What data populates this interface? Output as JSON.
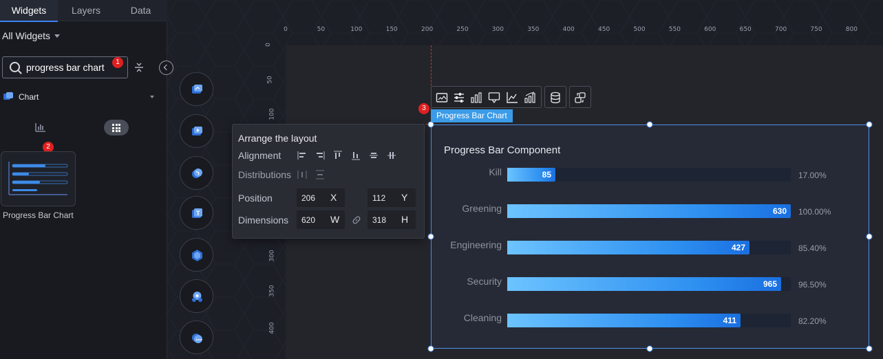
{
  "tabs": [
    {
      "label": "Widgets"
    },
    {
      "label": "Layers"
    },
    {
      "label": "Data"
    }
  ],
  "filter": {
    "label": "All Widgets"
  },
  "search": {
    "value": "progress bar chart"
  },
  "badges": [
    "1",
    "2",
    "3"
  ],
  "category": {
    "label": "Chart"
  },
  "widget": {
    "label": "Progress Bar Chart"
  },
  "ruler": {
    "top": [
      "0",
      "50",
      "100",
      "150",
      "200",
      "250",
      "300",
      "350",
      "400",
      "450",
      "500",
      "550",
      "600",
      "650",
      "700",
      "750",
      "800"
    ],
    "left": [
      "0",
      "50",
      "100",
      "300",
      "350",
      "400"
    ]
  },
  "arrange": {
    "title": "Arrange the layout",
    "alignment_label": "Alignment",
    "distributions_label": "Distributions",
    "position_label": "Position",
    "dimensions_label": "Dimensions",
    "x": "206",
    "x_unit": "X",
    "y": "112",
    "y_unit": "Y",
    "w": "620",
    "w_unit": "W",
    "h": "318",
    "h_unit": "H"
  },
  "selection": {
    "label": "Progress Bar Chart"
  },
  "chart_data": {
    "type": "bar",
    "title": "Progress Bar Component",
    "categories": [
      "Kill",
      "Greening",
      "Engineering",
      "Security",
      "Cleaning"
    ],
    "values": [
      85,
      630,
      427,
      965,
      411
    ],
    "percent_labels": [
      "17.00%",
      "100.00%",
      "85.40%",
      "96.50%",
      "82.20%"
    ],
    "fill_fraction": [
      0.17,
      1.0,
      0.854,
      0.965,
      0.822
    ],
    "colors": {
      "fill_start": "#6cc3ff",
      "fill_end": "#1a6fe0",
      "track": "#1d2433"
    }
  },
  "colors": {
    "accent": "#3b82f6",
    "selection": "#3b9be8",
    "badge": "#e02020"
  }
}
